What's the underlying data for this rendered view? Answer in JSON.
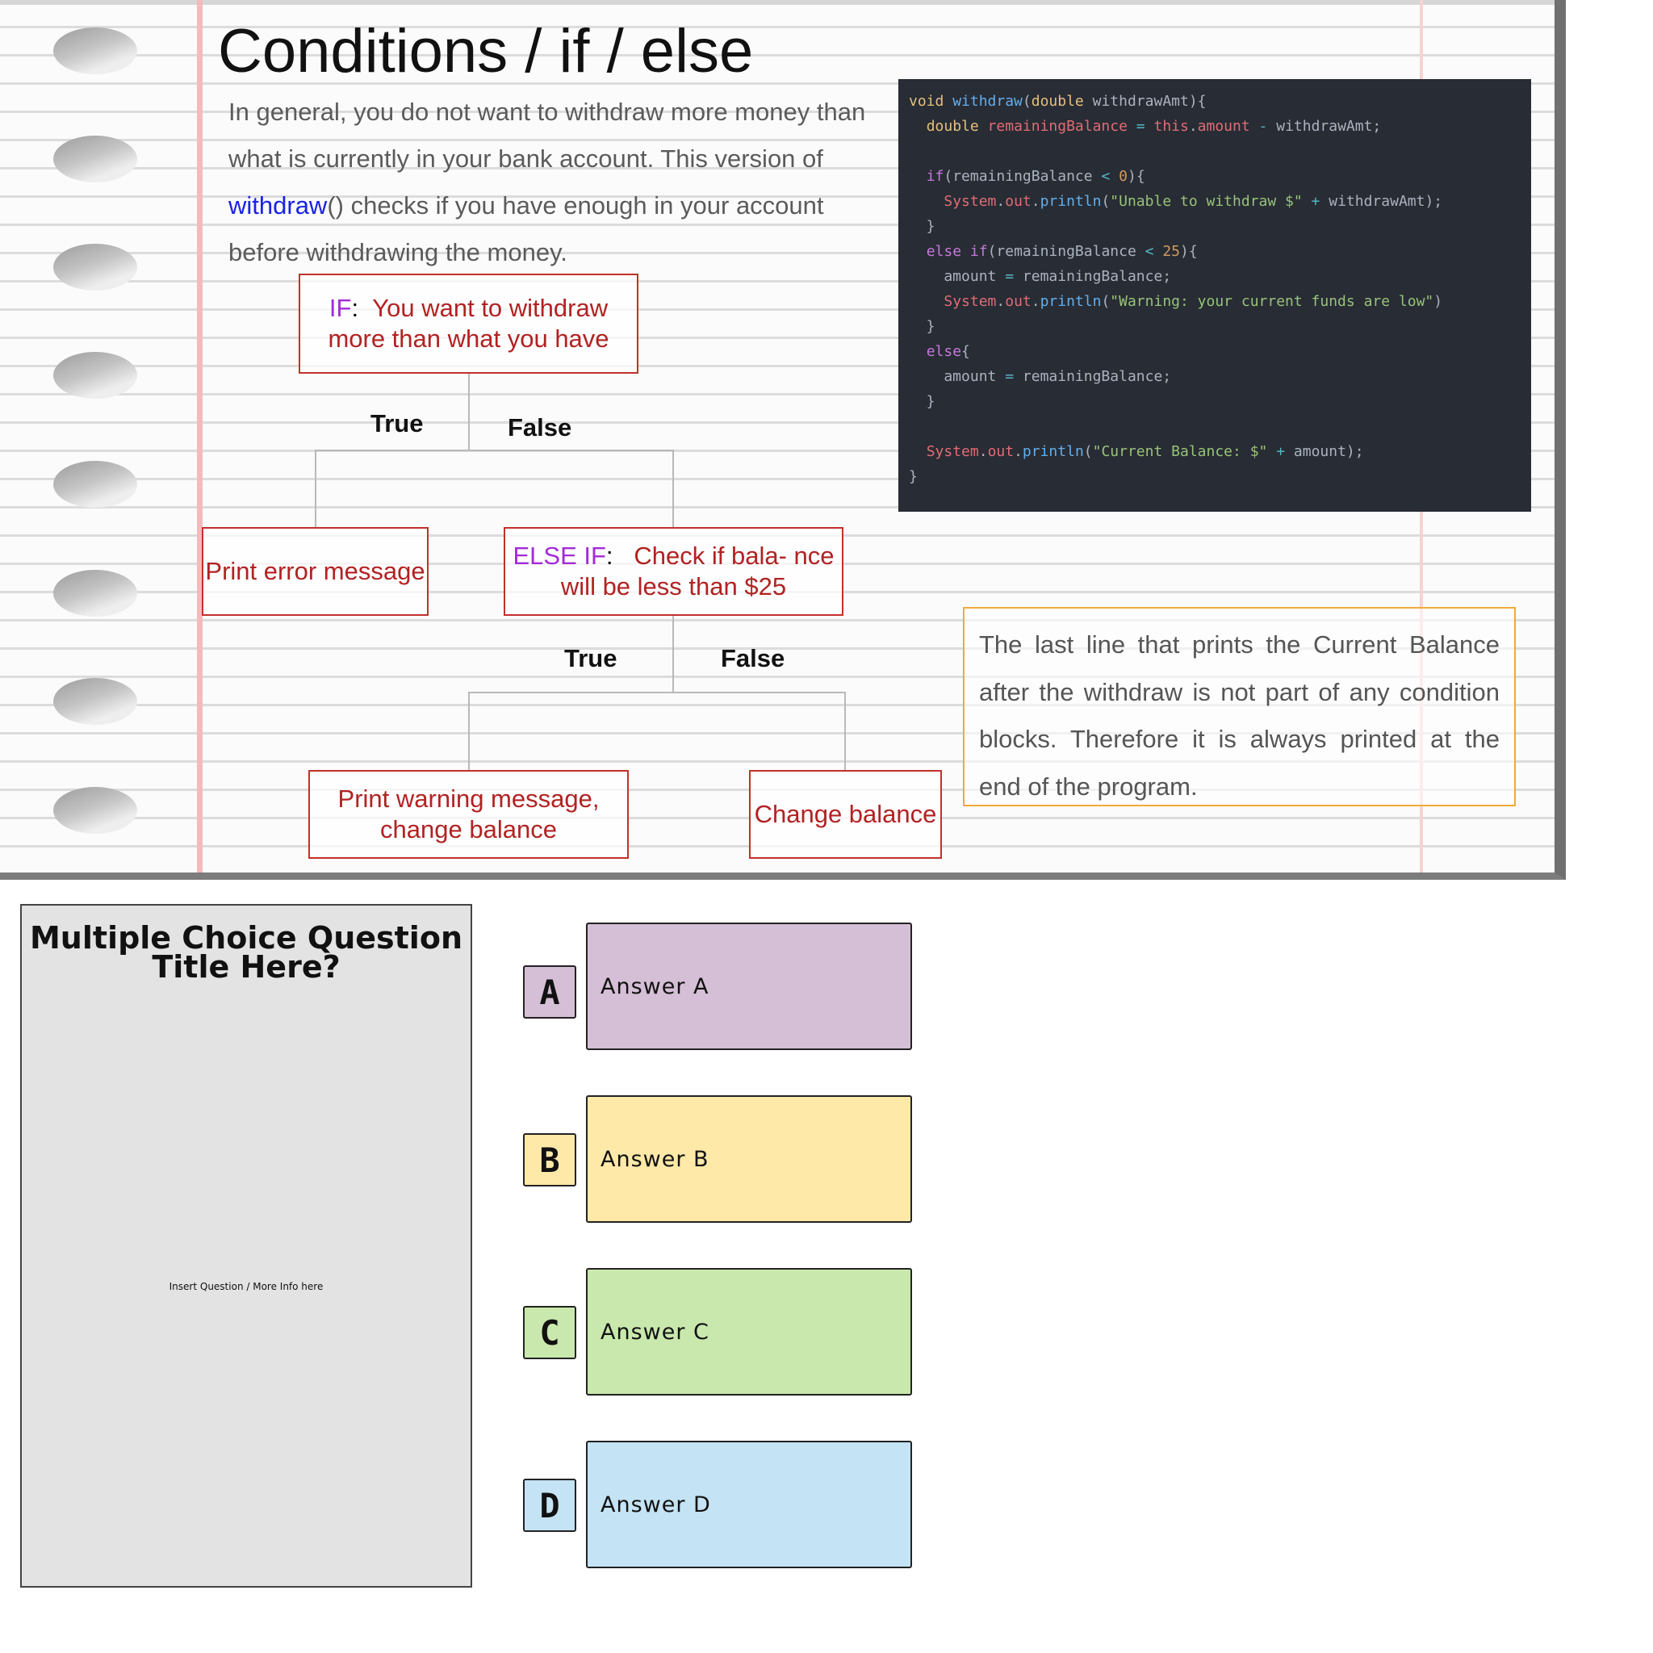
{
  "slide": {
    "title": "Conditions / if / else",
    "intro": {
      "part1": "In general, you do not want to withdraw more money than what is currently in your bank account. This version of ",
      "method": "withdraw",
      "part2": "() checks if you have enough in your account before withdrawing the money."
    },
    "code_lines": [
      [
        [
          "t-type",
          "void"
        ],
        [
          "",
          ""
        ],
        [
          "t-fn",
          " withdraw"
        ],
        [
          "",
          "("
        ],
        [
          "t-type",
          "double"
        ],
        [
          "",
          " withdrawAmt){"
        ]
      ],
      [
        [
          "",
          "  "
        ],
        [
          "t-type",
          "double"
        ],
        [
          "t-var",
          " remainingBalance"
        ],
        [
          "t-op",
          " ="
        ],
        [
          "t-var",
          " this"
        ],
        [
          "",
          "."
        ],
        [
          "t-var",
          "amount"
        ],
        [
          "t-op",
          " -"
        ],
        [
          "",
          " withdrawAmt;"
        ]
      ],
      [],
      [
        [
          "",
          "  "
        ],
        [
          "t-kw",
          "if"
        ],
        [
          "",
          "(remainingBalance "
        ],
        [
          "t-op",
          "<"
        ],
        [
          "t-num",
          " 0"
        ],
        [
          "",
          "){"
        ]
      ],
      [
        [
          "",
          "    "
        ],
        [
          "t-var",
          "System"
        ],
        [
          "",
          "."
        ],
        [
          "t-var",
          "out"
        ],
        [
          "",
          "."
        ],
        [
          "t-fn",
          "println"
        ],
        [
          "",
          "("
        ],
        [
          "t-str",
          "\"Unable to withdraw $\""
        ],
        [
          "t-op",
          " +"
        ],
        [
          "",
          " withdrawAmt);"
        ]
      ],
      [
        [
          "",
          "  }"
        ]
      ],
      [
        [
          "",
          "  "
        ],
        [
          "t-kw",
          "else"
        ],
        [
          "t-kw",
          " if"
        ],
        [
          "",
          "(remainingBalance "
        ],
        [
          "t-op",
          "<"
        ],
        [
          "t-num",
          " 25"
        ],
        [
          "",
          "){"
        ]
      ],
      [
        [
          "",
          "    amount "
        ],
        [
          "t-op",
          "="
        ],
        [
          "",
          " remainingBalance;"
        ]
      ],
      [
        [
          "",
          "    "
        ],
        [
          "t-var",
          "System"
        ],
        [
          "",
          "."
        ],
        [
          "t-var",
          "out"
        ],
        [
          "",
          "."
        ],
        [
          "t-fn",
          "println"
        ],
        [
          "",
          "("
        ],
        [
          "t-str",
          "\"Warning: your current funds are low\""
        ],
        [
          "",
          ")"
        ]
      ],
      [
        [
          "",
          "  }"
        ]
      ],
      [
        [
          "",
          "  "
        ],
        [
          "t-kw",
          "else"
        ],
        [
          "",
          "{"
        ]
      ],
      [
        [
          "",
          "    amount "
        ],
        [
          "t-op",
          "="
        ],
        [
          "",
          " remainingBalance;"
        ]
      ],
      [
        [
          "",
          "  }"
        ]
      ],
      [],
      [
        [
          "",
          "  "
        ],
        [
          "t-var",
          "System"
        ],
        [
          "",
          "."
        ],
        [
          "t-var",
          "out"
        ],
        [
          "",
          "."
        ],
        [
          "t-fn",
          "println"
        ],
        [
          "",
          "("
        ],
        [
          "t-str",
          "\"Current Balance: $\""
        ],
        [
          "t-op",
          " +"
        ],
        [
          "",
          " amount);"
        ]
      ],
      [
        [
          "",
          "}"
        ]
      ]
    ],
    "flow": {
      "if_keyword": "IF",
      "if_text": "You want to withdraw more than what you have",
      "true1": "True",
      "false1": "False",
      "error_box": "Print error message",
      "elseif_keyword": "ELSE IF",
      "elseif_text": "Check if bala- nce will be less than $25",
      "true2": "True",
      "false2": "False",
      "warning_box": "Print warning message, change balance",
      "change_box": "Change balance"
    },
    "note": "The last line that prints the Current Balance after the withdraw is not part of any condition blocks. Therefore it is always printed at the end of the program."
  },
  "quiz": {
    "title": "Multiple Choice Question Title Here?",
    "info": "Insert Question / More Info here",
    "options": [
      {
        "letter": "A",
        "label": "Answer A",
        "color": "#d5bfd6"
      },
      {
        "letter": "B",
        "label": "Answer B",
        "color": "#ffe9a8"
      },
      {
        "letter": "C",
        "label": "Answer C",
        "color": "#c9e8ad"
      },
      {
        "letter": "D",
        "label": "Answer D",
        "color": "#c4e3f4"
      }
    ]
  }
}
